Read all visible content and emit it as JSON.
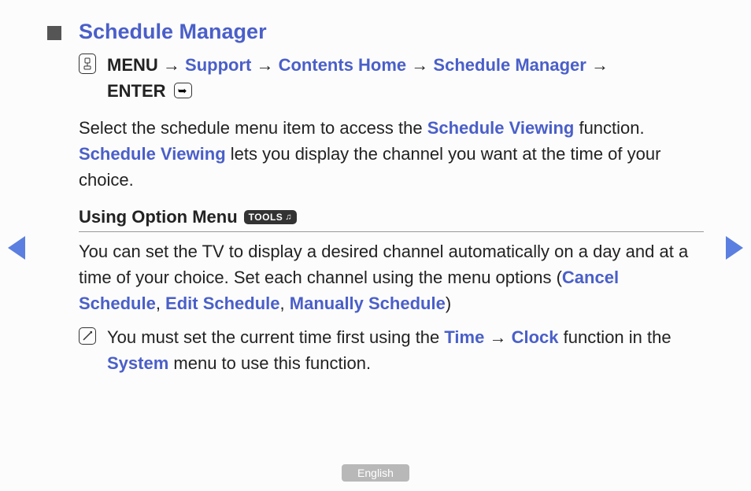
{
  "title": "Schedule Manager",
  "nav": {
    "menu": "MENU",
    "path1": "Support",
    "path2": "Contents Home",
    "path3": "Schedule Manager",
    "enter": "ENTER",
    "arrow": "→"
  },
  "intro": {
    "t1": "Select the schedule menu item to access the ",
    "link1": "Schedule Viewing",
    "t2": " function. ",
    "link2": "Schedule Viewing",
    "t3": " lets you display the channel you want at the time of your choice."
  },
  "option": {
    "heading": "Using Option Menu",
    "tools": "TOOLS",
    "t1": "You can set the TV to display a desired channel automatically on a day and at a time of your choice. Set each channel using the menu options (",
    "link1": "Cancel Schedule",
    "sep1": ", ",
    "link2": "Edit Schedule",
    "sep2": ", ",
    "link3": "Manually Schedule",
    "t2": ")"
  },
  "note": {
    "t1": "You must set the current time first using the ",
    "link1": "Time",
    "arrow": " → ",
    "link2": "Clock",
    "t2": " function in the ",
    "link3": "System",
    "t3": " menu to use this function."
  },
  "lang": "English"
}
